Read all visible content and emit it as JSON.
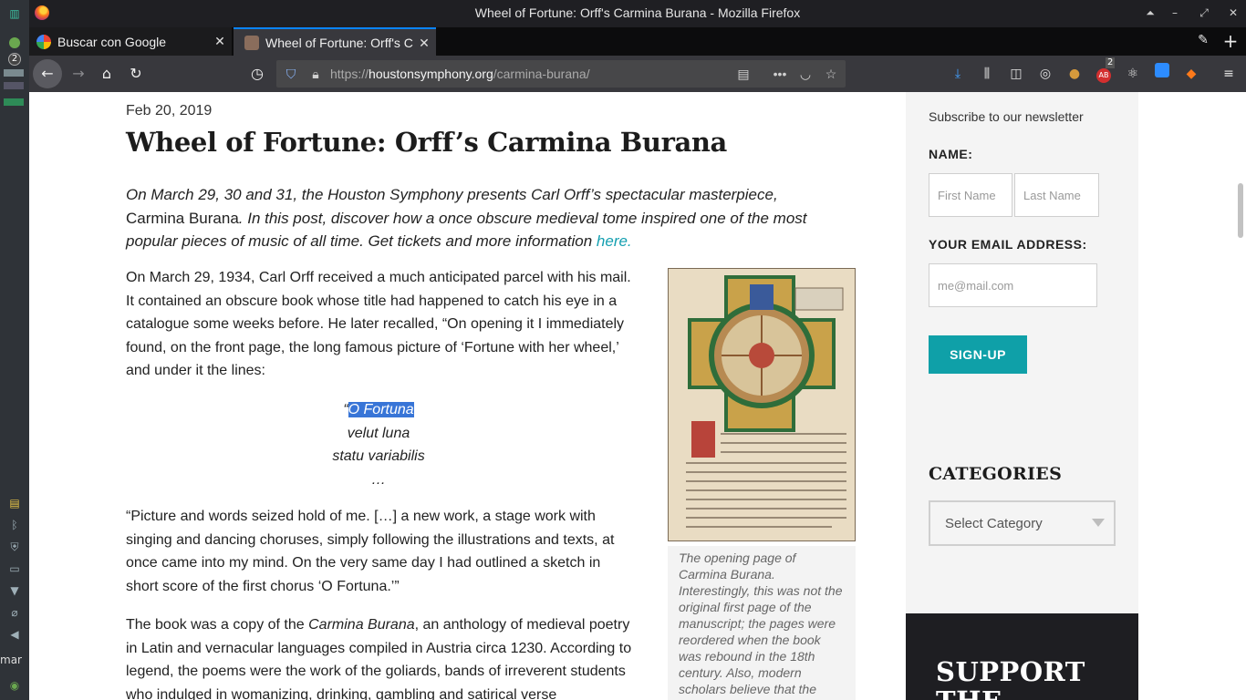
{
  "window": {
    "title": "Wheel of Fortune: Orff's Carmina Burana - Mozilla Firefox"
  },
  "tabs": [
    {
      "label": "Buscar con Google",
      "icon": "google-icon"
    },
    {
      "label": "Wheel of Fortune: Orff's C",
      "icon": "houston-symphony-icon"
    }
  ],
  "urlbar": {
    "url_prefix": "https://",
    "url_domain": "houstonsymphony.org",
    "url_path": "/carmina-burana/"
  },
  "toolbar": {
    "adblock_badge": "2"
  },
  "desktop": {
    "notify_badge": "2",
    "taskbar_text": "mar"
  },
  "article": {
    "date": "Feb 20, 2019",
    "title": "Wheel of Fortune: Orff’s Carmina Burana",
    "lead_part1": "On March 29, 30 and 31, the Houston Symphony presents Carl Orff’s spectacular masterpiece,",
    "lead_work": " Carmina Burana",
    "lead_part2": ". In this post, discover how a once obscure medieval tome inspired one of the most popular pieces of music of all time. Get tickets and more information ",
    "lead_link": "here.",
    "p1": "On March 29, 1934, Carl Orff received a much anticipated parcel with his mail. It contained an obscure book whose title had happened to catch his eye in a catalogue some weeks before. He later recalled, “On opening it I immediately found, on the front page, the long famous picture of ‘Fortune with her wheel,’ and under it the lines:",
    "poem": {
      "open_quote": "“",
      "selected": "O Fortuna",
      "line2": "velut luna",
      "line3": "statu variabilis",
      "line4": "…"
    },
    "p2": "“Picture and words seized hold of me. […] a new work, a stage work with singing and dancing choruses, simply following the illustrations and texts, at once came into my mind. On the very same day I had outlined a sketch in short score of the first chorus ‘O Fortuna.’”",
    "p3_before": "The book was a copy of the ",
    "p3_work": "Carmina Burana",
    "p3_after": ", an anthology of medieval poetry in Latin and vernacular languages compiled in Austria circa 1230. According to legend, the poems were the work of the goliards, bands of irreverent students who indulged in womanizing, drinking, gambling and satirical verse",
    "caption": "The opening page of Carmina Burana. Interestingly, this was not the original first page of the manuscript; the pages were reordered when the book was rebound in the 18th century. Also, modern scholars believe that the"
  },
  "sidebar": {
    "subscribe": "Subscribe to our newsletter",
    "name_label": "NAME:",
    "first_placeholder": "First Name",
    "last_placeholder": "Last Name",
    "email_label": "YOUR EMAIL ADDRESS:",
    "email_placeholder": "me@mail.com",
    "signup": "SIGN-UP",
    "categories_heading": "CATEGORIES",
    "select_value": "Select Category",
    "support_text": "SUPPORT THE"
  },
  "colors": {
    "accent": "#0fa0a8",
    "link": "#139fb0",
    "selection": "#3875d7"
  }
}
